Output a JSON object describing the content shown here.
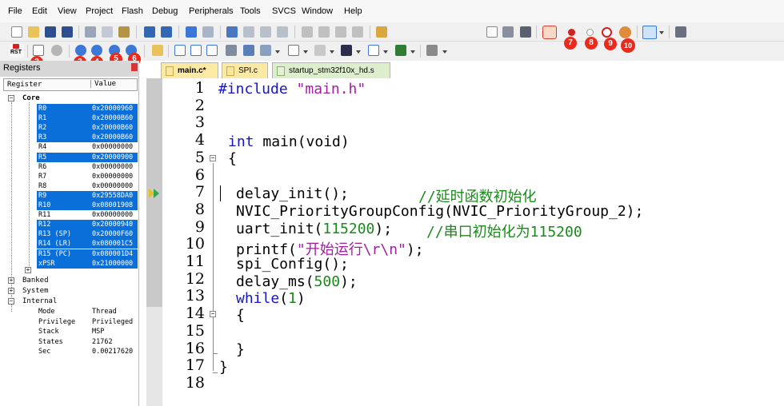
{
  "menu": [
    "File",
    "Edit",
    "View",
    "Project",
    "Flash",
    "Debug",
    "Peripherals",
    "Tools",
    "SVCS",
    "Window",
    "Help"
  ],
  "toolbar": {
    "rst_label": "RST"
  },
  "markers": [
    "1",
    "2",
    "3",
    "4",
    "5",
    "6",
    "7",
    "8",
    "9",
    "10"
  ],
  "panel": {
    "title": "Registers",
    "col_register": "Register",
    "col_value": "Value"
  },
  "tree": {
    "core": "Core",
    "banked": "Banked",
    "system": "System",
    "internal": "Internal"
  },
  "registers": [
    {
      "name": "R0",
      "value": "0x20000960",
      "selected": true
    },
    {
      "name": "R1",
      "value": "0x20000B60",
      "selected": true
    },
    {
      "name": "R2",
      "value": "0x20000B60",
      "selected": true
    },
    {
      "name": "R3",
      "value": "0x20000B60",
      "selected": true
    },
    {
      "name": "R4",
      "value": "0x00000000",
      "selected": false
    },
    {
      "name": "R5",
      "value": "0x20000900",
      "selected": true
    },
    {
      "name": "R6",
      "value": "0x00000000",
      "selected": false
    },
    {
      "name": "R7",
      "value": "0x00000000",
      "selected": false
    },
    {
      "name": "R8",
      "value": "0x00000000",
      "selected": false
    },
    {
      "name": "R9",
      "value": "0x29558DA0",
      "selected": true
    },
    {
      "name": "R10",
      "value": "0x08001908",
      "selected": true
    },
    {
      "name": "R11",
      "value": "0x00000000",
      "selected": false
    },
    {
      "name": "R12",
      "value": "0x20000940",
      "selected": true
    },
    {
      "name": "R13 (SP)",
      "value": "0x20000F60",
      "selected": true
    },
    {
      "name": "R14 (LR)",
      "value": "0x080001C5",
      "selected": true
    },
    {
      "name": "R15 (PC)",
      "value": "0x080001D4",
      "selected": true
    },
    {
      "name": "xPSR",
      "value": "0x21000000",
      "selected": true
    }
  ],
  "internal": [
    {
      "name": "Mode",
      "value": "Thread"
    },
    {
      "name": "Privilege",
      "value": "Privileged"
    },
    {
      "name": "Stack",
      "value": "MSP"
    },
    {
      "name": "States",
      "value": "21762"
    },
    {
      "name": "Sec",
      "value": "0.00217620"
    }
  ],
  "tabs": [
    "main.c*",
    "SPI.c",
    "startup_stm32f10x_hd.s"
  ],
  "line_numbers": [
    "1",
    "2",
    "3",
    "4",
    "5",
    "6",
    "7",
    "8",
    "9",
    "10",
    "11",
    "12",
    "13",
    "14",
    "15",
    "16",
    "17",
    "18"
  ],
  "code": {
    "l1_kw": "#include",
    "l1_str": " \"main.h\"",
    "l4_kw": "int",
    "l4_rest": " main(void)",
    "l5": "{",
    "l7_code": "delay_init();",
    "l7_cm": "//延时函数初始化",
    "l8": "NVIC_PriorityGroupConfig(NVIC_PriorityGroup_2);",
    "l9_a": "uart_init(",
    "l9_num": "115200",
    "l9_b": ");",
    "l9_cm": "//串口初始化为115200",
    "l10_a": "printf(",
    "l10_str": "\"开始运行\\r\\n\"",
    "l10_b": ");",
    "l11": "spi_Config();",
    "l12_a": "delay_ms(",
    "l12_num": "500",
    "l12_b": ");",
    "l13_kw": "while",
    "l13_a": "(",
    "l13_num": "1",
    "l13_b": ")",
    "l14": "{",
    "l16": "}",
    "l17": "}"
  },
  "colors": {
    "selection": "#0a6fd8",
    "keyword": "#1414c8",
    "comment": "#1a8a1a",
    "marker": "#ea2a1c"
  }
}
